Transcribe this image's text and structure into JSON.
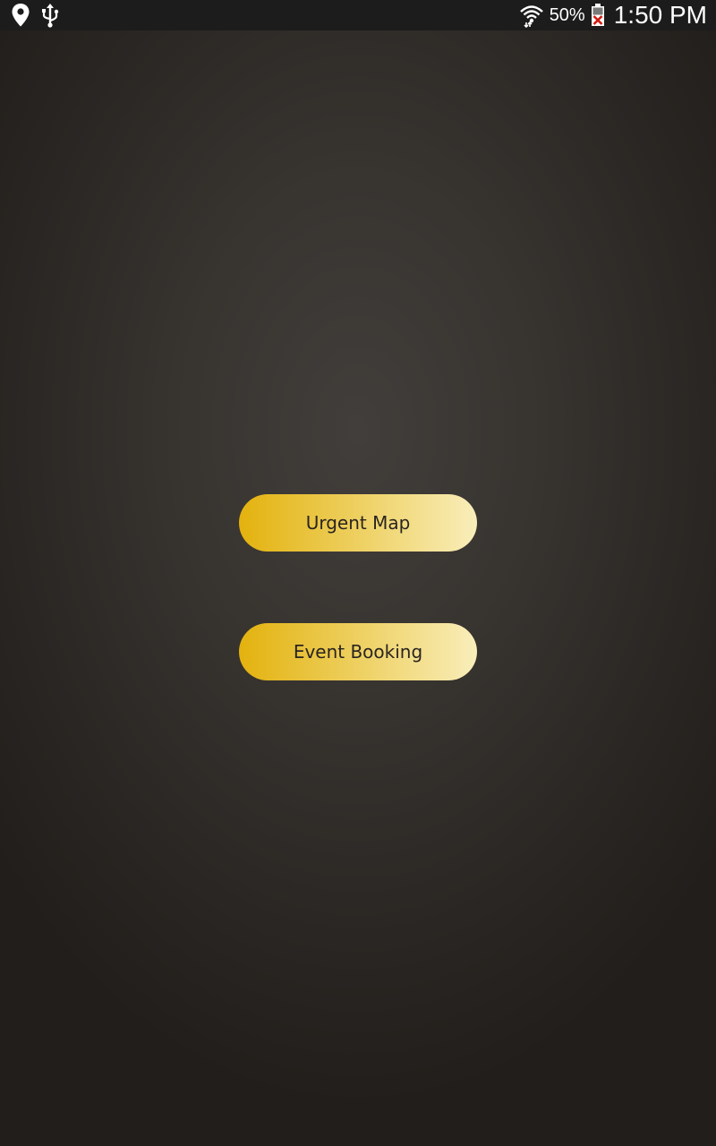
{
  "status_bar": {
    "left_icons": [
      "location-pin-icon",
      "usb-icon"
    ],
    "right_icons": [
      "wifi-icon",
      "battery-icon"
    ],
    "battery_percent": "50%",
    "time": "1:50 PM"
  },
  "buttons": {
    "urgent_map": "Urgent Map",
    "event_booking": "Event Booking"
  },
  "colors": {
    "button_gradient_start": "#e3b20e",
    "button_gradient_end": "#f9eebb",
    "button_text": "#2a2520",
    "background_center": "#423e3b",
    "background_edge": "#211e1b",
    "status_bar": "#1c1c1c"
  }
}
